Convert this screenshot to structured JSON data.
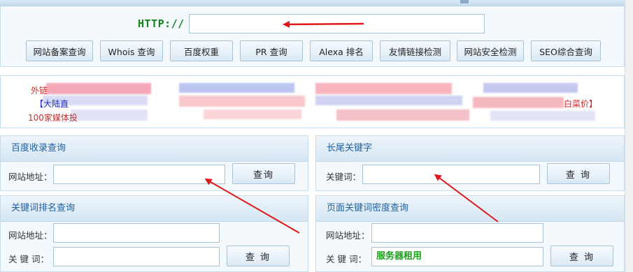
{
  "top": {
    "http_label": "HTTP://",
    "url_value": "",
    "buttons": [
      "网站备案查询",
      "Whois 查询",
      "百度权重",
      "PR 查询",
      "Alexa 排名",
      "友情链接检测",
      "网站安全检测",
      "SEO综合查询"
    ]
  },
  "ad": {
    "prefix1": "外链",
    "prefix2": "【大陆直",
    "prefix3": "100家媒体投",
    "suffix": "白菜价】"
  },
  "panels": {
    "baidu_index": {
      "title": "百度收录查询",
      "url_label": "网站地址：",
      "button": "查询"
    },
    "long_tail": {
      "title": "长尾关键字",
      "kw_label": "关键词：",
      "button": "查 询"
    },
    "keyword_rank": {
      "title": "关键词排名查询",
      "url_label": "网站地址：",
      "kw_label": "关 键 词：",
      "button": "查 询"
    },
    "density": {
      "title": "页面关键词密度查询",
      "url_label": "网站地址：",
      "kw_label": "关 键 词：",
      "kw_value": "服务器租用",
      "button": "查 询"
    }
  },
  "colors": {
    "accent_red": "#e01818",
    "http_green": "#15841d",
    "panel_title_blue": "#1f5fa0"
  }
}
